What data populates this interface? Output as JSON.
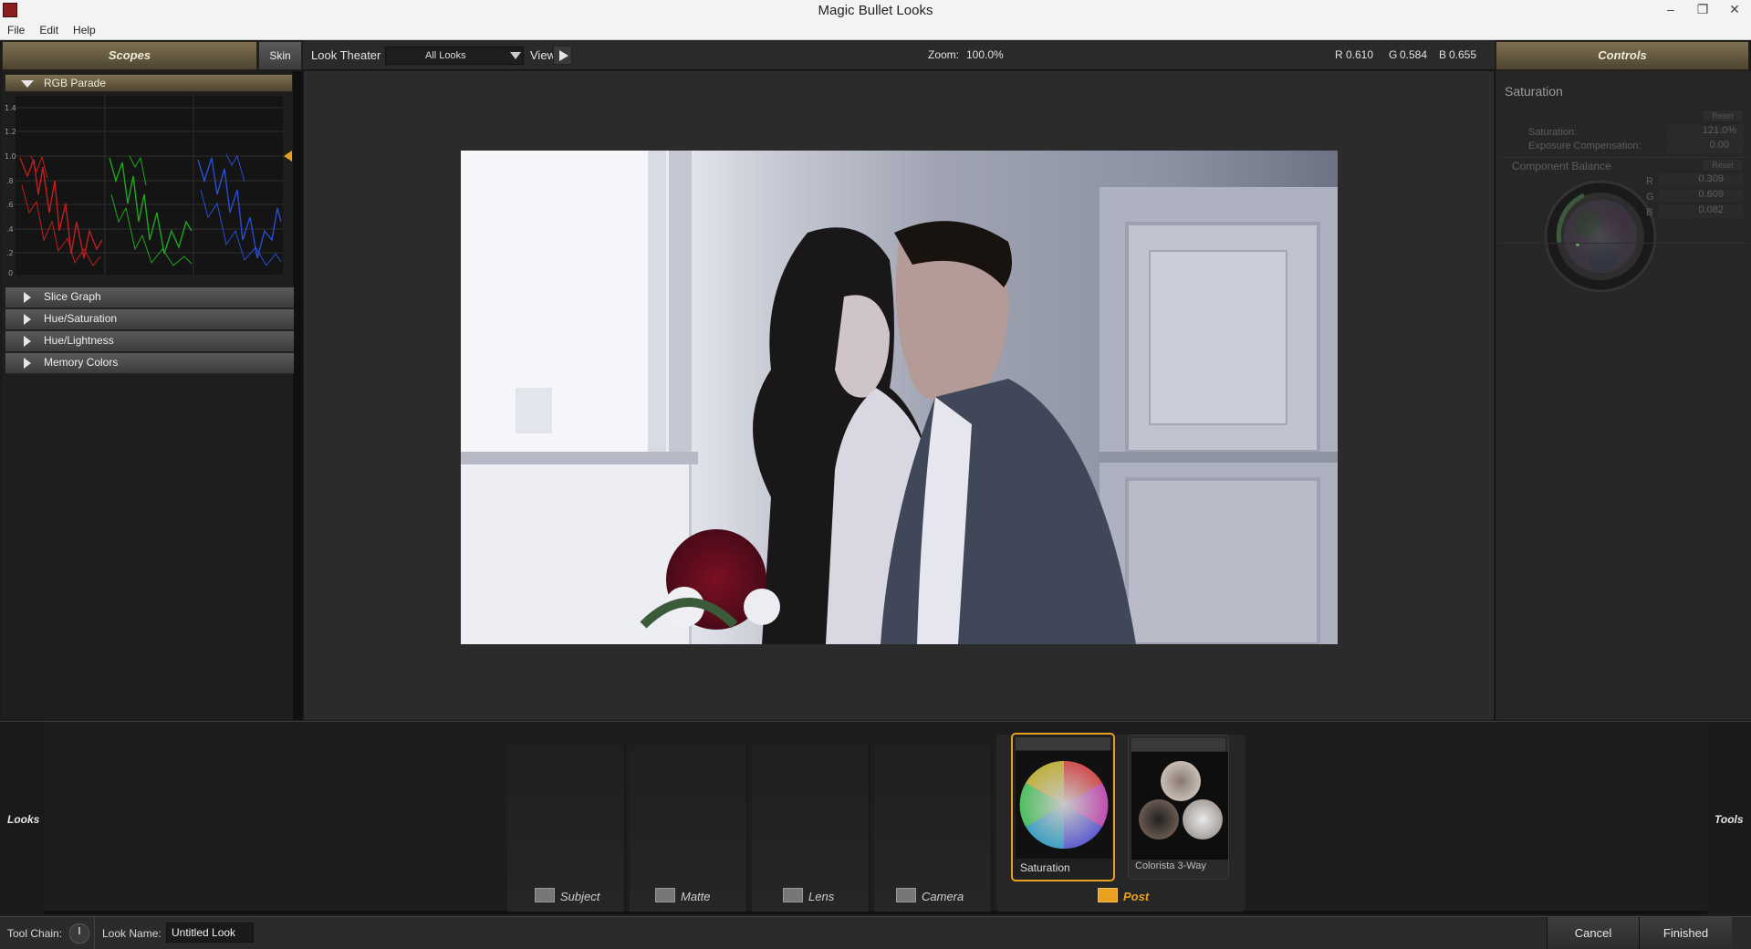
{
  "window": {
    "title": "Magic Bullet Looks",
    "controls": [
      "–",
      "❐",
      "✕"
    ]
  },
  "menu": [
    "File",
    "Edit",
    "Help"
  ],
  "scopes_panel": {
    "header": "Scopes",
    "skin_button": "Skin",
    "rgb_parade": {
      "label": "RGB Parade",
      "y_ticks": [
        "1.4",
        "1.2",
        "1.0",
        ".8",
        ".6",
        ".4",
        ".2",
        "0"
      ],
      "channels": [
        {
          "name": "R",
          "color": "#e02020"
        },
        {
          "name": "G",
          "color": "#20c020"
        },
        {
          "name": "B",
          "color": "#2a55e8"
        }
      ]
    },
    "sections": [
      "Slice Graph",
      "Hue/Saturation",
      "Hue/Lightness",
      "Memory Colors"
    ]
  },
  "topbar": {
    "look_theater_label": "Look Theater",
    "looks_select": "All Looks",
    "view_label": "View",
    "zoom_label": "Zoom:",
    "zoom_value": "100.0%",
    "rgb_readout": {
      "r_label": "R",
      "r": "0.610",
      "g_label": "G",
      "g": "0.584",
      "b_label": "B",
      "b": "0.655"
    }
  },
  "controls_panel": {
    "header": "Controls",
    "section_title": "Saturation",
    "reset_label": "Reset",
    "saturation_label": "Saturation:",
    "saturation_value": "121.0%",
    "exposure_label": "Exposure Compensation:",
    "exposure_value": "0.00",
    "component_balance_label": "Component Balance",
    "balance": {
      "r_label": "R",
      "r": "0.309",
      "g_label": "G",
      "g": "0.609",
      "b_label": "B",
      "b": "0.082"
    }
  },
  "toolchain": {
    "left_tab": "Looks",
    "right_tab": "Tools",
    "categories": [
      {
        "name": "Subject",
        "active": false
      },
      {
        "name": "Matte",
        "active": false
      },
      {
        "name": "Lens",
        "active": false
      },
      {
        "name": "Camera",
        "active": false
      },
      {
        "name": "Post",
        "active": true
      }
    ],
    "tools": [
      {
        "name": "Saturation",
        "selected": true
      },
      {
        "name": "Colorista 3-Way",
        "selected": false
      }
    ],
    "accent_color": "#e8a020"
  },
  "statusbar": {
    "tool_chain_label": "Tool Chain:",
    "look_name_label": "Look Name:",
    "look_name_value": "Untitled Look",
    "cancel_label": "Cancel",
    "finished_label": "Finished"
  }
}
